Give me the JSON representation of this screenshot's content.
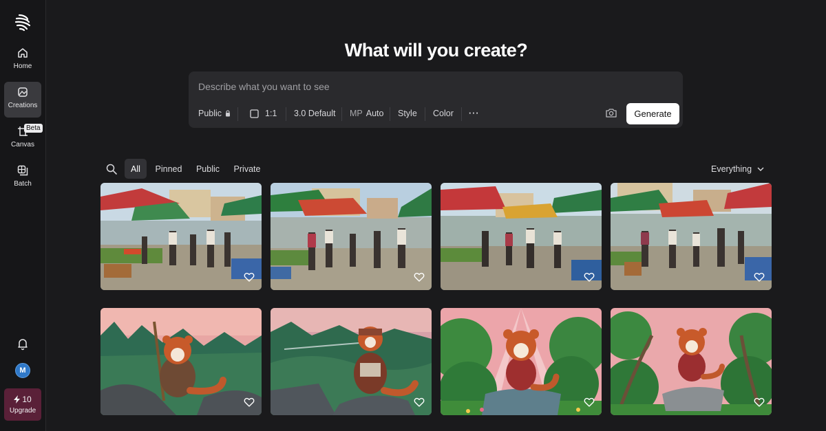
{
  "sidebar": {
    "items": [
      {
        "label": "Home",
        "icon": "home-icon"
      },
      {
        "label": "Creations",
        "icon": "creations-icon",
        "active": true
      },
      {
        "label": "Canvas",
        "icon": "canvas-icon",
        "badge": "Beta"
      },
      {
        "label": "Batch",
        "icon": "batch-icon"
      }
    ],
    "avatar_initial": "M",
    "credits": "10",
    "upgrade_label": "Upgrade"
  },
  "headline": "What will you create?",
  "prompt": {
    "placeholder": "Describe what you want to see",
    "visibility": "Public",
    "aspect": "1:1",
    "model": "3.0 Default",
    "mp_label": "MP",
    "mp_value": "Auto",
    "style": "Style",
    "color": "Color",
    "more": "···",
    "generate": "Generate"
  },
  "filters": {
    "tabs": [
      "All",
      "Pinned",
      "Public",
      "Private"
    ],
    "active": "All",
    "dropdown": "Everything"
  },
  "gallery": {
    "rows": [
      {
        "subject": "market",
        "count": 4
      },
      {
        "subject": "red-panda",
        "count": 4
      }
    ]
  },
  "colors": {
    "background": "#1a1a1c",
    "sidebar": "#161618",
    "prompt_box": "#2a2a2d",
    "upgrade": "#5a2038",
    "avatar": "#2f78c8"
  }
}
